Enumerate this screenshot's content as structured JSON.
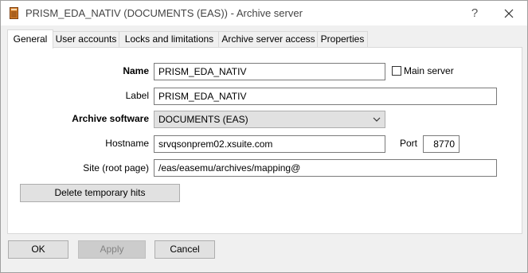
{
  "window": {
    "title": "PRISM_EDA_NATIV (DOCUMENTS (EAS)) - Archive server",
    "help_glyph": "?",
    "app_icon": "book-icon",
    "close_icon": "close-icon"
  },
  "tabs": [
    {
      "label": "General",
      "active": true
    },
    {
      "label": "User accounts",
      "active": false
    },
    {
      "label": "Locks and limitations",
      "active": false
    },
    {
      "label": "Archive server access",
      "active": false
    },
    {
      "label": "Properties",
      "active": false
    }
  ],
  "form": {
    "name_label": "Name",
    "name_value": "PRISM_EDA_NATIV",
    "main_server_label": "Main server",
    "main_server_checked": false,
    "label_label": "Label",
    "label_value": "PRISM_EDA_NATIV",
    "software_label": "Archive software",
    "software_value": "DOCUMENTS (EAS)",
    "hostname_label": "Hostname",
    "hostname_value": "srvqsonprem02.xsuite.com",
    "port_label": "Port",
    "port_value": "8770",
    "site_label": "Site (root page)",
    "site_value": "/eas/easemu/archives/mapping@",
    "delete_hits_label": "Delete temporary hits"
  },
  "footer": {
    "ok_label": "OK",
    "apply_label": "Apply",
    "cancel_label": "Cancel"
  }
}
